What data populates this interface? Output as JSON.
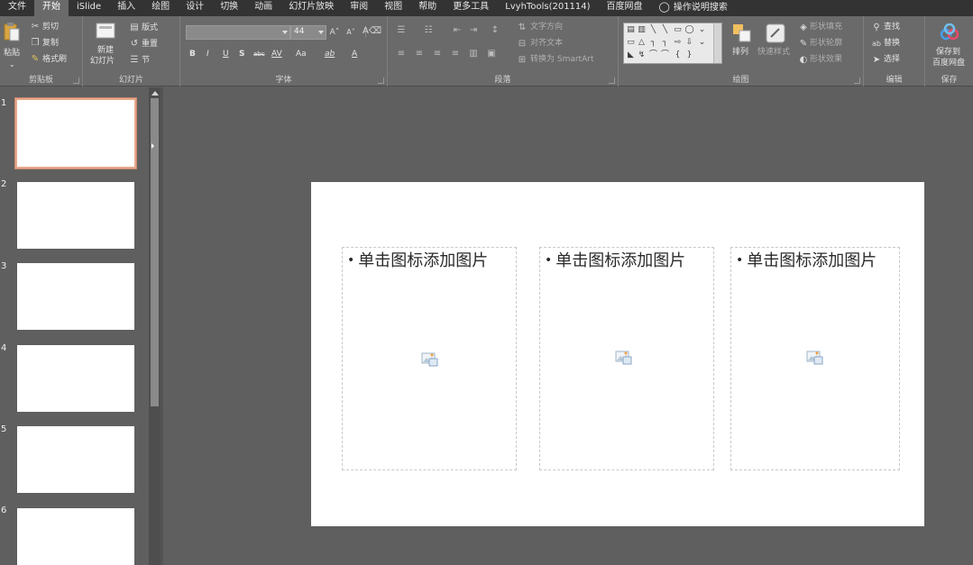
{
  "menu": {
    "tabs": [
      "文件",
      "开始",
      "iSlide",
      "插入",
      "绘图",
      "设计",
      "切换",
      "动画",
      "幻灯片放映",
      "审阅",
      "视图",
      "帮助",
      "更多工具",
      "LvyhTools(201114)",
      "百度网盘",
      "操作说明搜索"
    ],
    "active_tab": "开始"
  },
  "ribbon": {
    "clipboard": {
      "paste": "粘贴",
      "cut": "剪切",
      "copy": "复制",
      "format_painter": "格式刷",
      "label": "剪贴板"
    },
    "slides": {
      "new_slide_line1": "新建",
      "new_slide_line2": "幻灯片",
      "layout": "版式",
      "reset": "重置",
      "section": "节",
      "label": "幻灯片"
    },
    "font": {
      "font_name": "",
      "font_size": "44",
      "bold": "B",
      "italic": "I",
      "underline": "U",
      "shadow": "S",
      "strike": "abc",
      "spacing": "AV",
      "case": "Aa",
      "highlight": "ab",
      "font_color": "A",
      "label": "字体"
    },
    "paragraph": {
      "text_direction": "文字方向",
      "align_text": "对齐文本",
      "smartart": "转换为 SmartArt",
      "label": "段落"
    },
    "drawing": {
      "arrange": "排列",
      "quick_styles": "快速样式",
      "shape_fill": "形状填充",
      "shape_outline": "形状轮廓",
      "shape_effects": "形状效果",
      "label": "绘图"
    },
    "editing": {
      "find": "查找",
      "replace": "替换",
      "select": "选择",
      "label": "编辑"
    },
    "save": {
      "line1": "保存到",
      "line2": "百度网盘",
      "label": "保存"
    }
  },
  "thumbnails": {
    "numbers": [
      "1",
      "2",
      "3",
      "4",
      "5",
      "6"
    ],
    "selected_index": 1
  },
  "slide": {
    "placeholders": [
      {
        "text": "单击图标添加图片"
      },
      {
        "text": "单击图标添加图片"
      },
      {
        "text": "单击图标添加图片"
      }
    ]
  },
  "colors": {
    "menubar_bg": "#333333",
    "ribbon_bg": "#6a6a6a",
    "workspace_bg": "#5f5f5f",
    "selected_thumb_border": "#e8a88c"
  }
}
